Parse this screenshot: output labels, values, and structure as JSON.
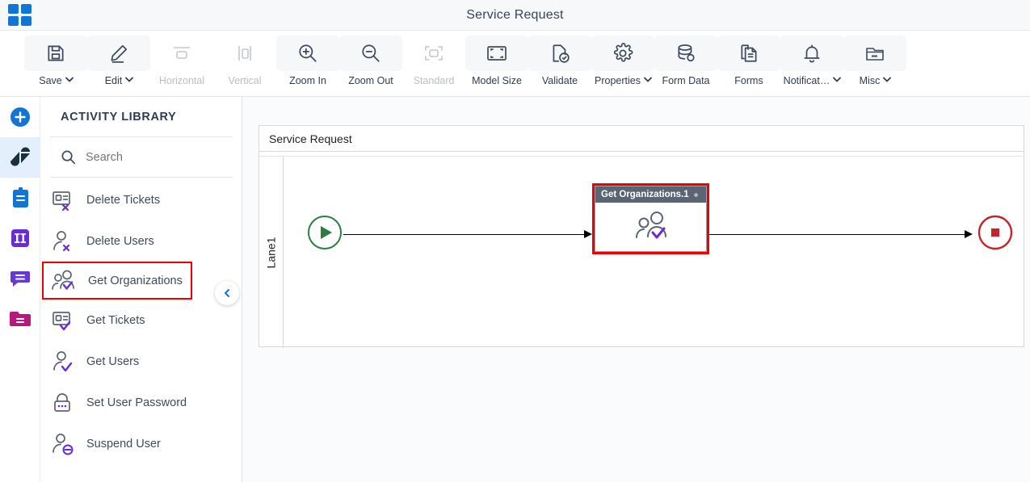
{
  "window": {
    "title": "Service Request",
    "app_logo": "app-grid-icon"
  },
  "toolbar": {
    "items": [
      {
        "label": "Save",
        "icon": "save-icon",
        "dropdown": true,
        "disabled": false
      },
      {
        "label": "Edit",
        "icon": "pencil-icon",
        "dropdown": true,
        "disabled": false
      },
      {
        "label": "Horizontal",
        "icon": "horizontal-icon",
        "dropdown": false,
        "disabled": true
      },
      {
        "label": "Vertical",
        "icon": "vertical-icon",
        "dropdown": false,
        "disabled": true
      },
      {
        "label": "Zoom In",
        "icon": "zoom-in-icon",
        "dropdown": false,
        "disabled": false
      },
      {
        "label": "Zoom Out",
        "icon": "zoom-out-icon",
        "dropdown": false,
        "disabled": false
      },
      {
        "label": "Standard",
        "icon": "standard-icon",
        "dropdown": false,
        "disabled": true
      },
      {
        "label": "Model Size",
        "icon": "model-size-icon",
        "dropdown": false,
        "disabled": false
      },
      {
        "label": "Validate",
        "icon": "validate-icon",
        "dropdown": false,
        "disabled": false
      },
      {
        "label": "Properties",
        "icon": "gear-icon",
        "dropdown": true,
        "disabled": false
      },
      {
        "label": "Form Data",
        "icon": "database-icon",
        "dropdown": false,
        "disabled": false
      },
      {
        "label": "Forms",
        "icon": "document-icon",
        "dropdown": false,
        "disabled": false
      },
      {
        "label": "Notificat…",
        "icon": "bell-icon",
        "dropdown": true,
        "disabled": false
      },
      {
        "label": "Misc",
        "icon": "folder-icon",
        "dropdown": true,
        "disabled": false
      }
    ]
  },
  "rail": {
    "items": [
      {
        "name": "add-button",
        "icon": "plus-circle-icon",
        "color": "#1274d4",
        "active": false
      },
      {
        "name": "zendesk-connector",
        "icon": "zendesk-logo-icon",
        "color": "#17323c",
        "active": true
      },
      {
        "name": "clipboard",
        "icon": "clipboard-icon",
        "color": "#1274d4",
        "active": false
      },
      {
        "name": "columns",
        "icon": "columns-icon",
        "color": "#6c2bd9",
        "active": false
      },
      {
        "name": "chat",
        "icon": "chat-icon",
        "color": "#6739d4",
        "active": false
      },
      {
        "name": "folder",
        "icon": "folder-icon",
        "color": "#b4197c",
        "active": false
      }
    ]
  },
  "library": {
    "title": "ACTIVITY LIBRARY",
    "search_placeholder": "Search",
    "search_value": "",
    "search_icon": "search-icon",
    "collapse_icon": "chevron-left-icon",
    "items": [
      {
        "label": "Delete Tickets",
        "icon": "card-delete-icon",
        "selected": false
      },
      {
        "label": "Delete Users",
        "icon": "user-delete-icon",
        "selected": false
      },
      {
        "label": "Get Organizations",
        "icon": "users-check-icon",
        "selected": true
      },
      {
        "label": "Get Tickets",
        "icon": "card-check-icon",
        "selected": false
      },
      {
        "label": "Get Users",
        "icon": "user-check-icon",
        "selected": false
      },
      {
        "label": "Set User Password",
        "icon": "lock-password-icon",
        "selected": false
      },
      {
        "label": "Suspend User",
        "icon": "user-suspend-icon",
        "selected": false
      }
    ]
  },
  "canvas": {
    "pool_name": "Service Request",
    "lane_name": "Lane1",
    "start_node": {
      "name": "start-event",
      "icon": "play-icon",
      "color": "#2e7d43"
    },
    "end_node": {
      "name": "end-event",
      "icon": "stop-icon",
      "color": "#c0272d"
    },
    "task": {
      "label": "Get Organizations.1",
      "icon": "users-check-icon",
      "settings_icon": "gear-icon",
      "header_color": "#5b6473",
      "selection_color": "#ee0000"
    }
  }
}
